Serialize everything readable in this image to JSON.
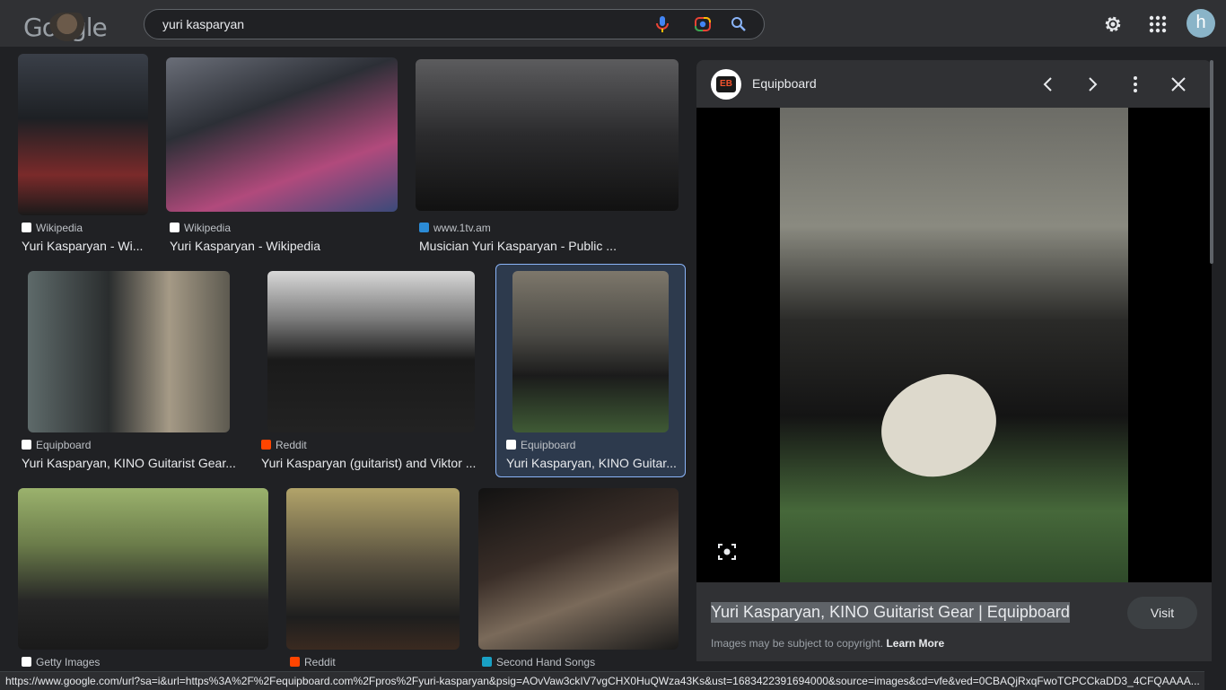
{
  "header": {
    "logo_text": "Google",
    "search_value": "yuri kasparyan",
    "avatar_letter": "h"
  },
  "results": [
    {
      "source": "Wikipedia",
      "title": "Yuri Kasparyan - Wi...",
      "icon": "wikipedia-icon",
      "icon_color": "#ffffff"
    },
    {
      "source": "Wikipedia",
      "title": "Yuri Kasparyan - Wikipedia",
      "icon": "wikipedia-icon",
      "icon_color": "#ffffff"
    },
    {
      "source": "www.1tv.am",
      "title": "Musician Yuri Kasparyan - Public ...",
      "icon": "1tv-icon",
      "icon_color": "#2b8bd6"
    },
    {
      "source": "Equipboard",
      "title": "Yuri Kasparyan, KINO Guitarist Gear...",
      "icon": "equipboard-icon",
      "icon_color": "#ffffff"
    },
    {
      "source": "Reddit",
      "title": "Yuri Kasparyan (guitarist) and Viktor ...",
      "icon": "reddit-icon",
      "icon_color": "#ff4500"
    },
    {
      "source": "Equipboard",
      "title": "Yuri Kasparyan, KINO Guitar...",
      "icon": "equipboard-icon",
      "icon_color": "#ffffff"
    },
    {
      "source": "Getty Images",
      "title": "",
      "icon": "getty-icon",
      "icon_color": "#ffffff"
    },
    {
      "source": "Reddit",
      "title": "",
      "icon": "reddit-icon",
      "icon_color": "#ff4500"
    },
    {
      "source": "Second Hand Songs",
      "title": "",
      "icon": "shs-icon",
      "icon_color": "#19a0c4"
    }
  ],
  "panel": {
    "site_logo": "EB",
    "site_name": "Equipboard",
    "title": "Yuri Kasparyan, KINO Guitarist Gear | Equipboard",
    "visit_label": "Visit",
    "copyright_text": "Images may be subject to copyright.",
    "learn_more": "Learn More"
  },
  "status_url": "https://www.google.com/url?sa=i&url=https%3A%2F%2Fequipboard.com%2Fpros%2Fyuri-kasparyan&psig=AOvVaw3ckIV7vgCHX0HuQWza43Ks&ust=1683422391694000&source=images&cd=vfe&ved=0CBAQjRxqFwoTCPCCkaDD3_4CFQAAAA...",
  "colors": {
    "accent": "#8ab4f8",
    "background": "#202124",
    "header": "#303134"
  }
}
